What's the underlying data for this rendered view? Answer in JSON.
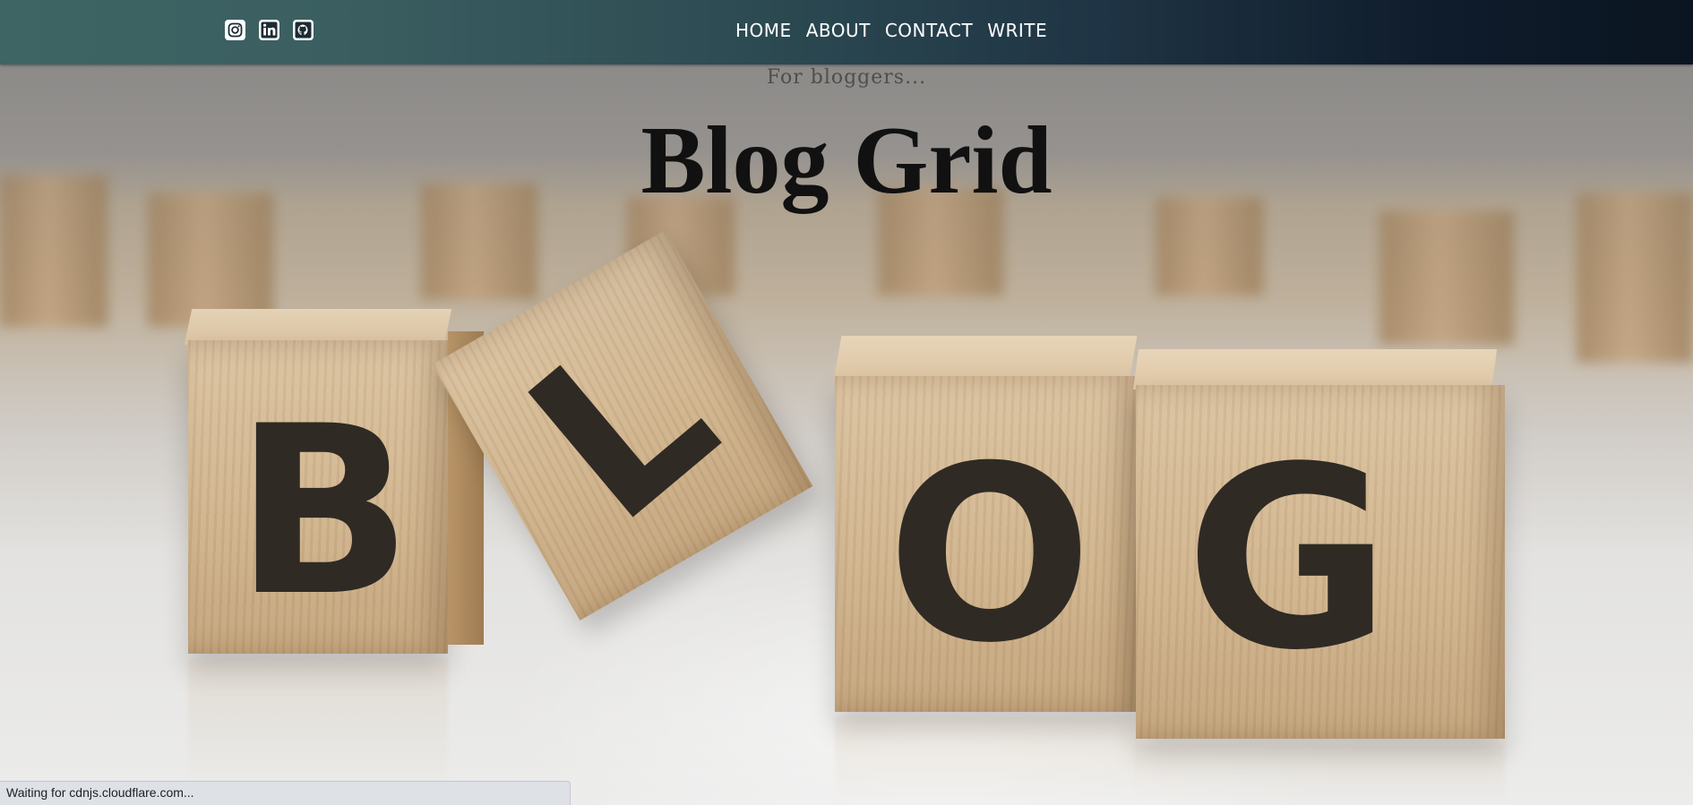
{
  "navbar": {
    "social_icons": [
      {
        "name": "instagram-icon",
        "color": "#ffffff"
      },
      {
        "name": "linkedin-icon",
        "color": "#ffffff"
      },
      {
        "name": "github-icon",
        "color": "#ffffff"
      }
    ],
    "links": [
      {
        "label": "HOME"
      },
      {
        "label": "ABOUT"
      },
      {
        "label": "CONTACT"
      },
      {
        "label": "WRITE"
      }
    ]
  },
  "hero": {
    "tagline": "For bloggers...",
    "title": "Blog Grid",
    "image_letters": [
      "B",
      "L",
      "O",
      "G"
    ]
  },
  "browser": {
    "status_text": "Waiting for cdnjs.cloudflare.com..."
  },
  "colors": {
    "navbar_start": "#3e6463",
    "navbar_end": "#0b1521",
    "title": "#111111",
    "tagline": "#4e4e4e"
  }
}
